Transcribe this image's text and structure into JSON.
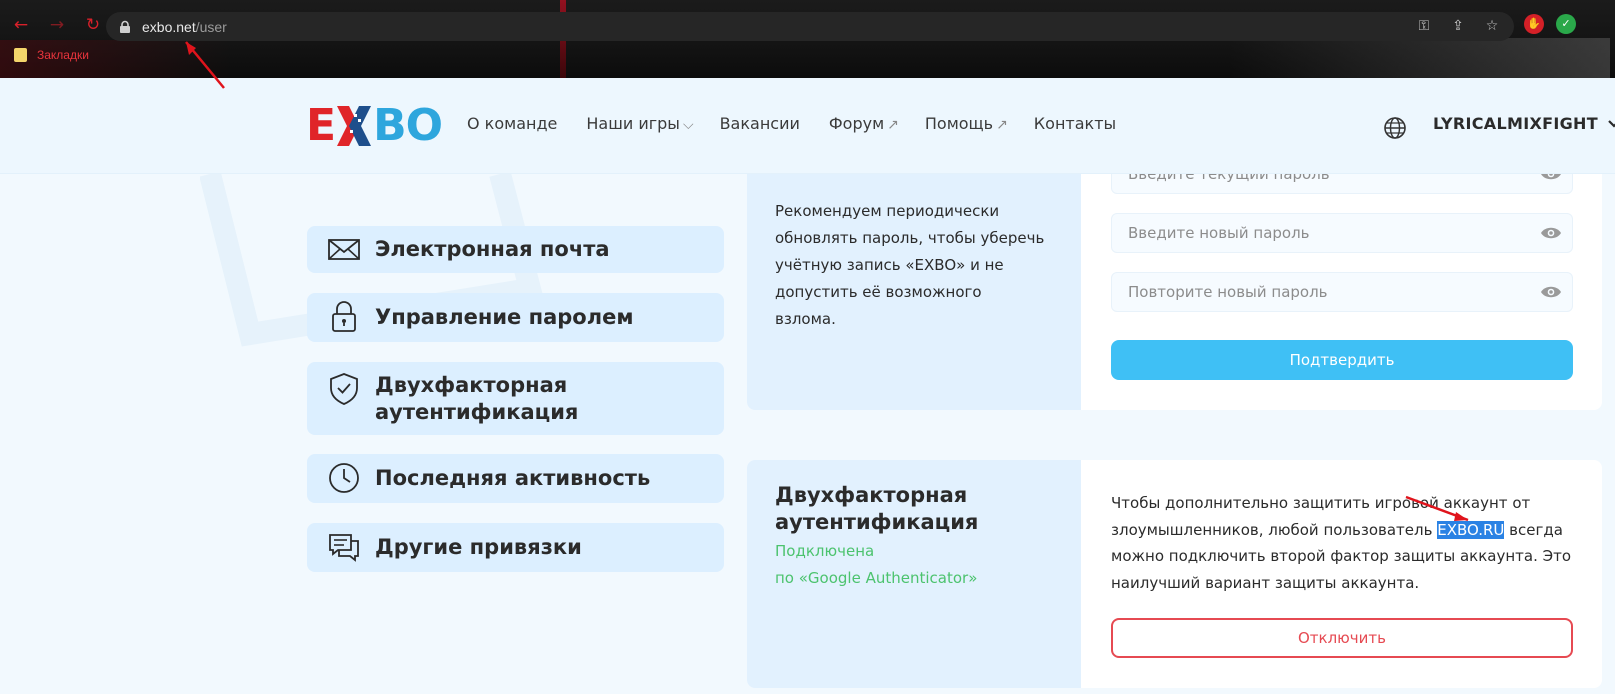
{
  "browser": {
    "url_host": "exbo.net",
    "url_path": "/user",
    "bookmark_folder": "Закладки",
    "ext1": "✋",
    "ext2": "✓"
  },
  "header": {
    "logo_left": "E",
    "logo_right": "BO",
    "nav": [
      {
        "label": "О команде",
        "suffix": ""
      },
      {
        "label": "Наши игры",
        "suffix": "⌵"
      },
      {
        "label": "Вакансии",
        "suffix": ""
      },
      {
        "label": "Форум",
        "suffix": "↗"
      },
      {
        "label": "Помощь",
        "suffix": "↗"
      },
      {
        "label": "Контакты",
        "suffix": ""
      }
    ],
    "username": "LYRICALMIXFIGHT"
  },
  "side_menu": [
    {
      "label": "Электронная почта",
      "icon": "envelope-icon"
    },
    {
      "label": "Управление паролем",
      "icon": "lock-icon"
    },
    {
      "label": "Двухфакторная аутентификация",
      "icon": "shield-check-icon"
    },
    {
      "label": "Последняя активность",
      "icon": "clock-icon"
    },
    {
      "label": "Другие привязки",
      "icon": "chat-icon"
    }
  ],
  "password_card": {
    "description": "Рекомендуем периодически обновлять пароль, чтобы уберечь учётную запись «EXBO» и не допустить её возможного взлома.",
    "fields": {
      "current": "Введите текущий пароль",
      "new": "Введите новый пароль",
      "repeat": "Повторите новый пароль"
    },
    "confirm_label": "Подтвердить"
  },
  "twofa_card": {
    "title": "Двухфакторная аутентификация",
    "status": "Подключена",
    "status_method": "по «Google Authenticator»",
    "body_before": "Чтобы дополнительно защитить игровой аккаунт от злоумышленников, любой пользователь ",
    "body_highlight": "EXBO.RU",
    "body_after": " всегда можно подключить второй фактор защиты аккаунта. Это наилучший вариант защиты аккаунта.",
    "disable_label": "Отключить"
  },
  "colors": {
    "accent_blue": "#3fc0f5",
    "danger_red": "#e64a52",
    "success_green": "#4cc36e",
    "logo_red": "#e02529",
    "logo_blue": "#2ea6dd"
  }
}
